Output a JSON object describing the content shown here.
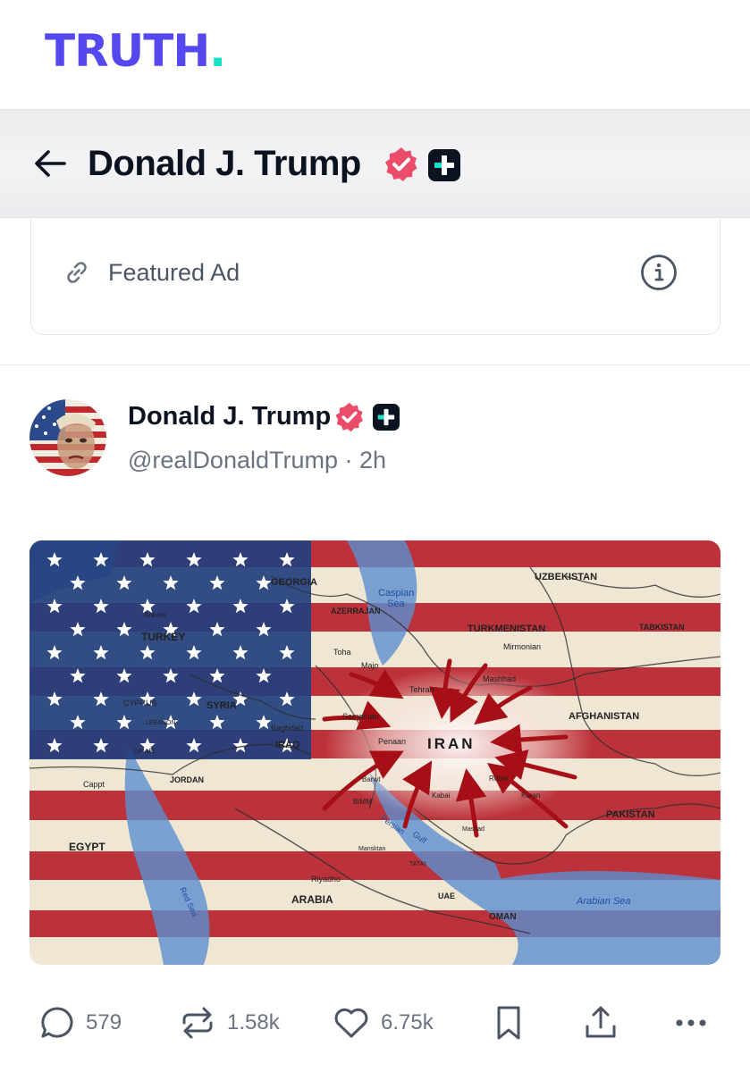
{
  "app": {
    "logo_text": "TRUTH",
    "logo_dot": ".",
    "brand_color": "#5448ee",
    "accent_color": "#17e2c7"
  },
  "header": {
    "title": "Donald J. Trump",
    "back_icon": "arrow-left-icon",
    "verified_icon": "verified-badge-icon",
    "plus_icon": "truth-plus-icon"
  },
  "ad": {
    "label": "Featured Ad",
    "link_icon": "link-icon",
    "info_icon": "info-icon"
  },
  "post": {
    "author": {
      "name": "Donald J. Trump",
      "handle": "@realDonaldTrump",
      "separator": " · ",
      "time": "2h"
    },
    "image": {
      "map_labels": {
        "georgia": "GEORGIA",
        "azerbaijan": "AZERRAJAN",
        "caspian": "Caspian",
        "caspian2": "Sea",
        "uzbekistan": "UZBEKISTAN",
        "tajikistan": "TABKISTAN",
        "turkmenistan": "TURKMENISTAN",
        "mirmonian": "Mirmonian",
        "turkey": "TURKEY",
        "ankara": "Ankara",
        "toha": "Toha",
        "majo": "Majo",
        "tehran": "Tehran",
        "mashhad": "Mashhad",
        "syria": "SYRIA",
        "cyprus": "CYPRUS",
        "lebanon": "LEBANON",
        "baghdad": "Baghdad",
        "iraq": "IRAQ",
        "samaihan": "Samaihan",
        "afghanistan": "AFGHANISTAN",
        "israel": "ISRAEL",
        "penaan": "Penaan",
        "iran": "IRAN",
        "jordan": "JORDAN",
        "cappt": "Cappt",
        "barwt": "Barwt",
        "robar": "Robar",
        "kabai": "Kabai",
        "kuran": "Kuran",
        "bimm": "BIMM",
        "pakistan": "PAKISTAN",
        "egypt": "EGYPT",
        "persian": "Persian",
        "gulf": "Gulf",
        "mansktan": "Mansktan",
        "mashad": "Mashad",
        "tatai": "TATAI",
        "riyadh": "Riyadho",
        "arabia": "ARABIA",
        "uae": "UAE",
        "oman": "OMAN",
        "arabian_sea": "Arabian Sea",
        "red_sea": "Red Sea"
      }
    },
    "actions": {
      "replies": "579",
      "retruths": "1.58k",
      "likes": "6.75k",
      "bookmark_icon": "bookmark-icon",
      "share_icon": "share-icon",
      "more_icon": "more-horizontal-icon"
    }
  }
}
